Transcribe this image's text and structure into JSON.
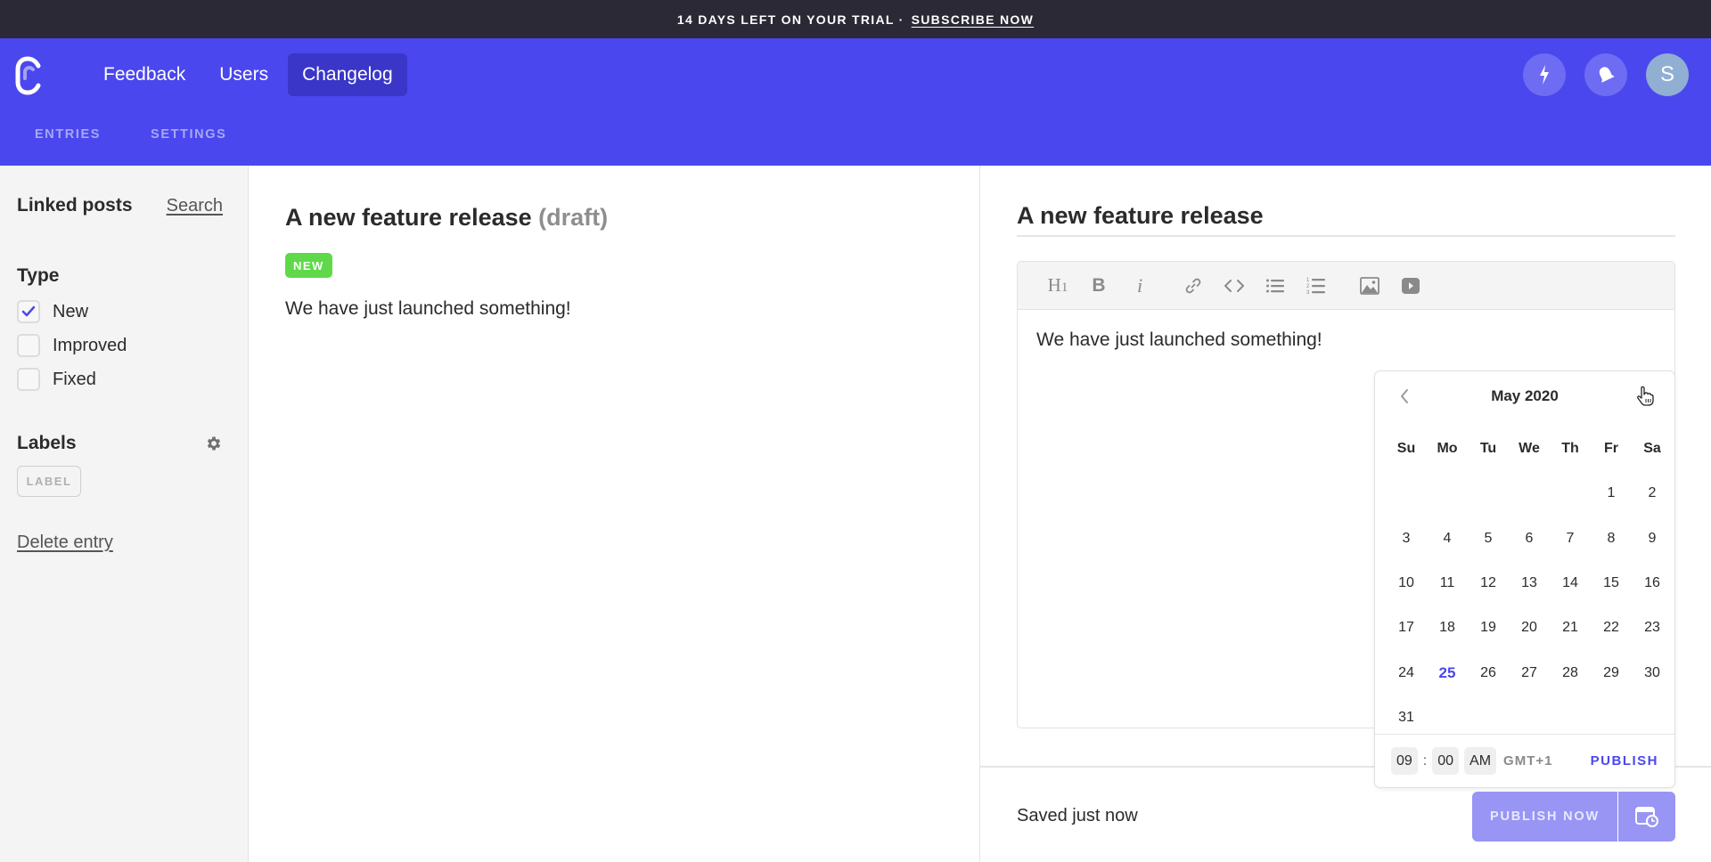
{
  "banner": {
    "text": "14 DAYS LEFT ON YOUR TRIAL ·",
    "link": "SUBSCRIBE NOW"
  },
  "header": {
    "logo": "canny-logo-icon",
    "nav": [
      {
        "label": "Feedback",
        "active": false
      },
      {
        "label": "Users",
        "active": false
      },
      {
        "label": "Changelog",
        "active": true
      }
    ],
    "actions": [
      {
        "icon": "lightning-icon"
      },
      {
        "icon": "bell-icon"
      }
    ],
    "avatar_initial": "S",
    "subnav": [
      {
        "label": "ENTRIES"
      },
      {
        "label": "SETTINGS"
      }
    ]
  },
  "sidebar": {
    "linked_posts_label": "Linked posts",
    "search_link": "Search",
    "type_heading": "Type",
    "types": [
      {
        "label": "New",
        "checked": true
      },
      {
        "label": "Improved",
        "checked": false
      },
      {
        "label": "Fixed",
        "checked": false
      }
    ],
    "labels_heading": "Labels",
    "label_placeholder": "LABEL",
    "delete_link": "Delete entry"
  },
  "preview": {
    "title": "A new feature release",
    "status": "(draft)",
    "badge": "NEW",
    "body": "We have just launched something!"
  },
  "editor": {
    "title_value": "A new feature release",
    "toolbar": [
      {
        "name": "heading-icon",
        "glyph": "H1"
      },
      {
        "name": "bold-icon",
        "glyph": "B"
      },
      {
        "name": "italic-icon",
        "glyph": "i"
      },
      {
        "name": "link-icon",
        "glyph": ""
      },
      {
        "name": "code-icon",
        "glyph": ""
      },
      {
        "name": "bullet-list-icon",
        "glyph": ""
      },
      {
        "name": "numbered-list-icon",
        "glyph": ""
      },
      {
        "name": "image-icon",
        "glyph": ""
      },
      {
        "name": "video-icon",
        "glyph": ""
      }
    ],
    "body": "We have just launched something!"
  },
  "calendar": {
    "month_label": "May 2020",
    "weekdays": [
      "Su",
      "Mo",
      "Tu",
      "We",
      "Th",
      "Fr",
      "Sa"
    ],
    "leading_blanks": 5,
    "days_in_month": 31,
    "selected_day": 25,
    "time": {
      "hour": "09",
      "minute": "00",
      "period": "AM",
      "timezone": "GMT+1"
    },
    "publish_label": "PUBLISH"
  },
  "footer": {
    "saved_status": "Saved just now",
    "publish_now_label": "PUBLISH NOW",
    "schedule_icon": "calendar-clock-icon"
  },
  "colors": {
    "brand": "#4a47ee",
    "banner_bg": "#2a2935",
    "badge_new": "#5fd94a",
    "publish_button": "#9895f5"
  }
}
